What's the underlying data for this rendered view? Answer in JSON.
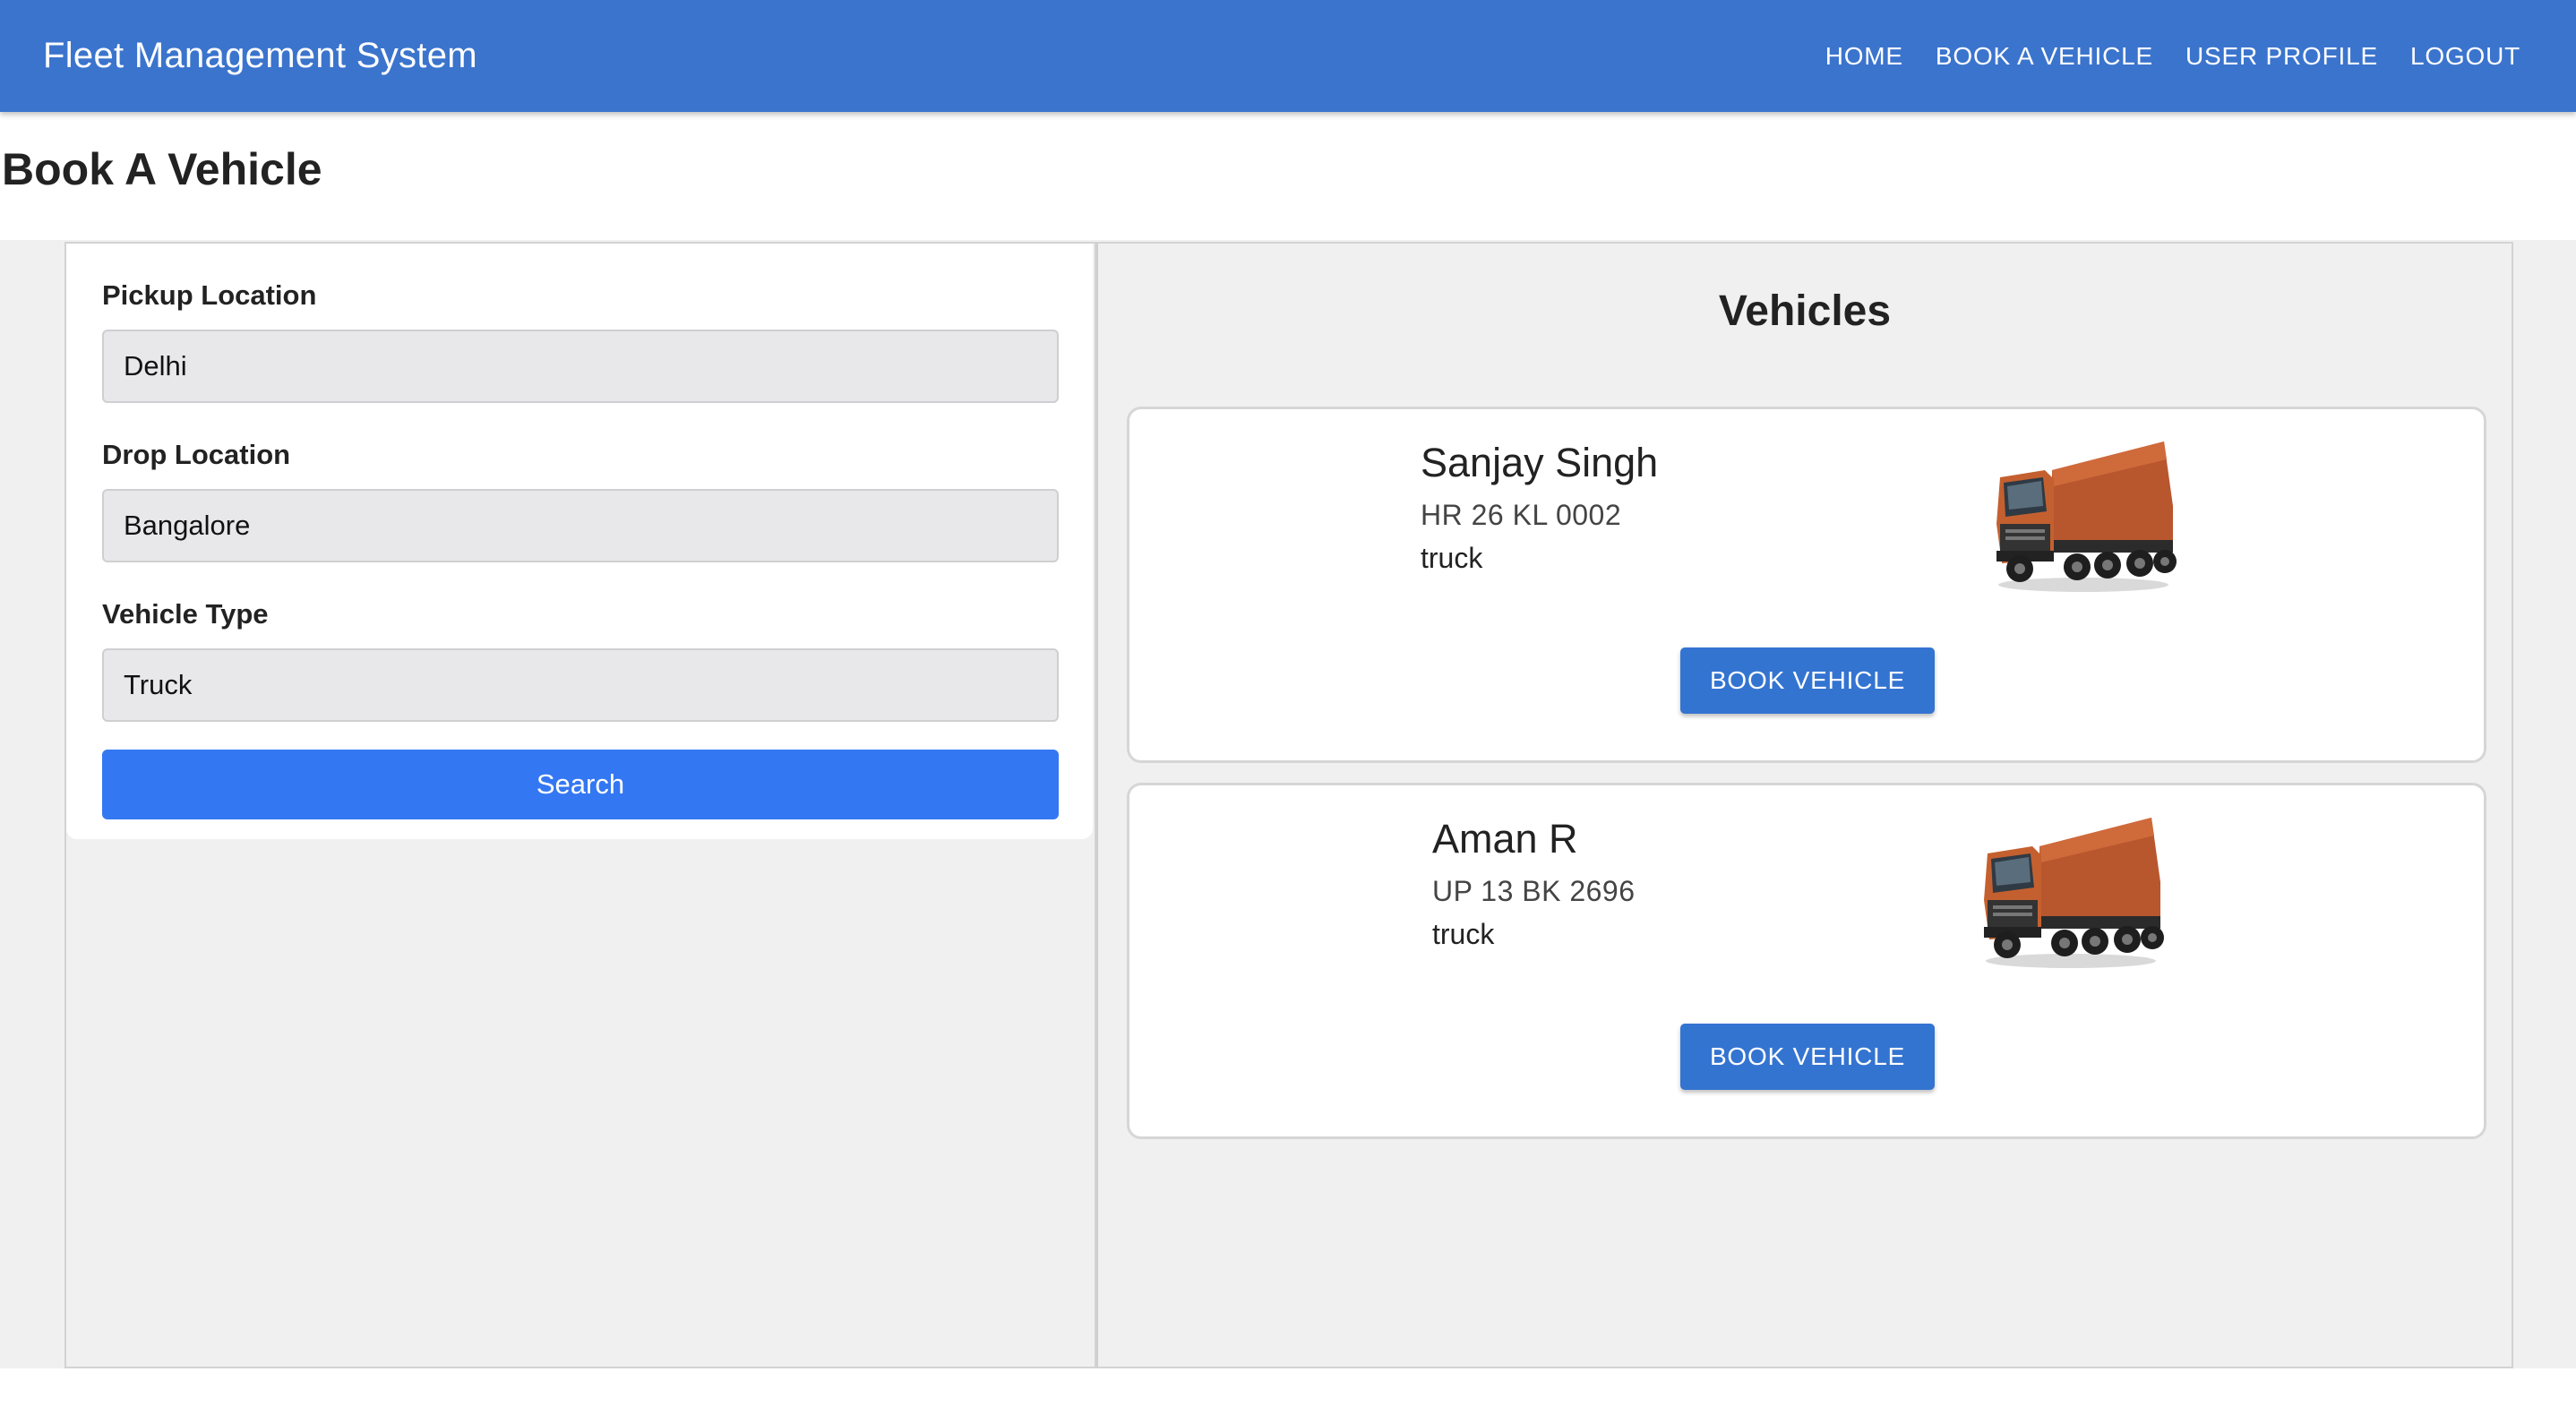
{
  "header": {
    "brand": "Fleet Management System",
    "nav": [
      {
        "label": "HOME"
      },
      {
        "label": "BOOK A VEHICLE"
      },
      {
        "label": "USER PROFILE"
      },
      {
        "label": "LOGOUT"
      }
    ]
  },
  "page": {
    "title": "Book A Vehicle"
  },
  "form": {
    "pickup": {
      "label": "Pickup Location",
      "value": "Delhi"
    },
    "drop": {
      "label": "Drop Location",
      "value": "Bangalore"
    },
    "type": {
      "label": "Vehicle Type",
      "value": "Truck"
    },
    "search_label": "Search"
  },
  "vehicles": {
    "title": "Vehicles",
    "items": [
      {
        "driver": "Sanjay Singh",
        "plate": "HR 26 KL 0002",
        "type": "truck",
        "button": "BOOK VEHICLE",
        "icon": "truck-image"
      },
      {
        "driver": "Aman R",
        "plate": "UP 13 BK 2696",
        "type": "truck",
        "button": "BOOK VEHICLE",
        "icon": "truck-image"
      }
    ]
  },
  "colors": {
    "appbar": "#3b74cd",
    "search_button": "#3477f2",
    "book_button": "#3474d1",
    "truck_body": "#b8562e"
  }
}
